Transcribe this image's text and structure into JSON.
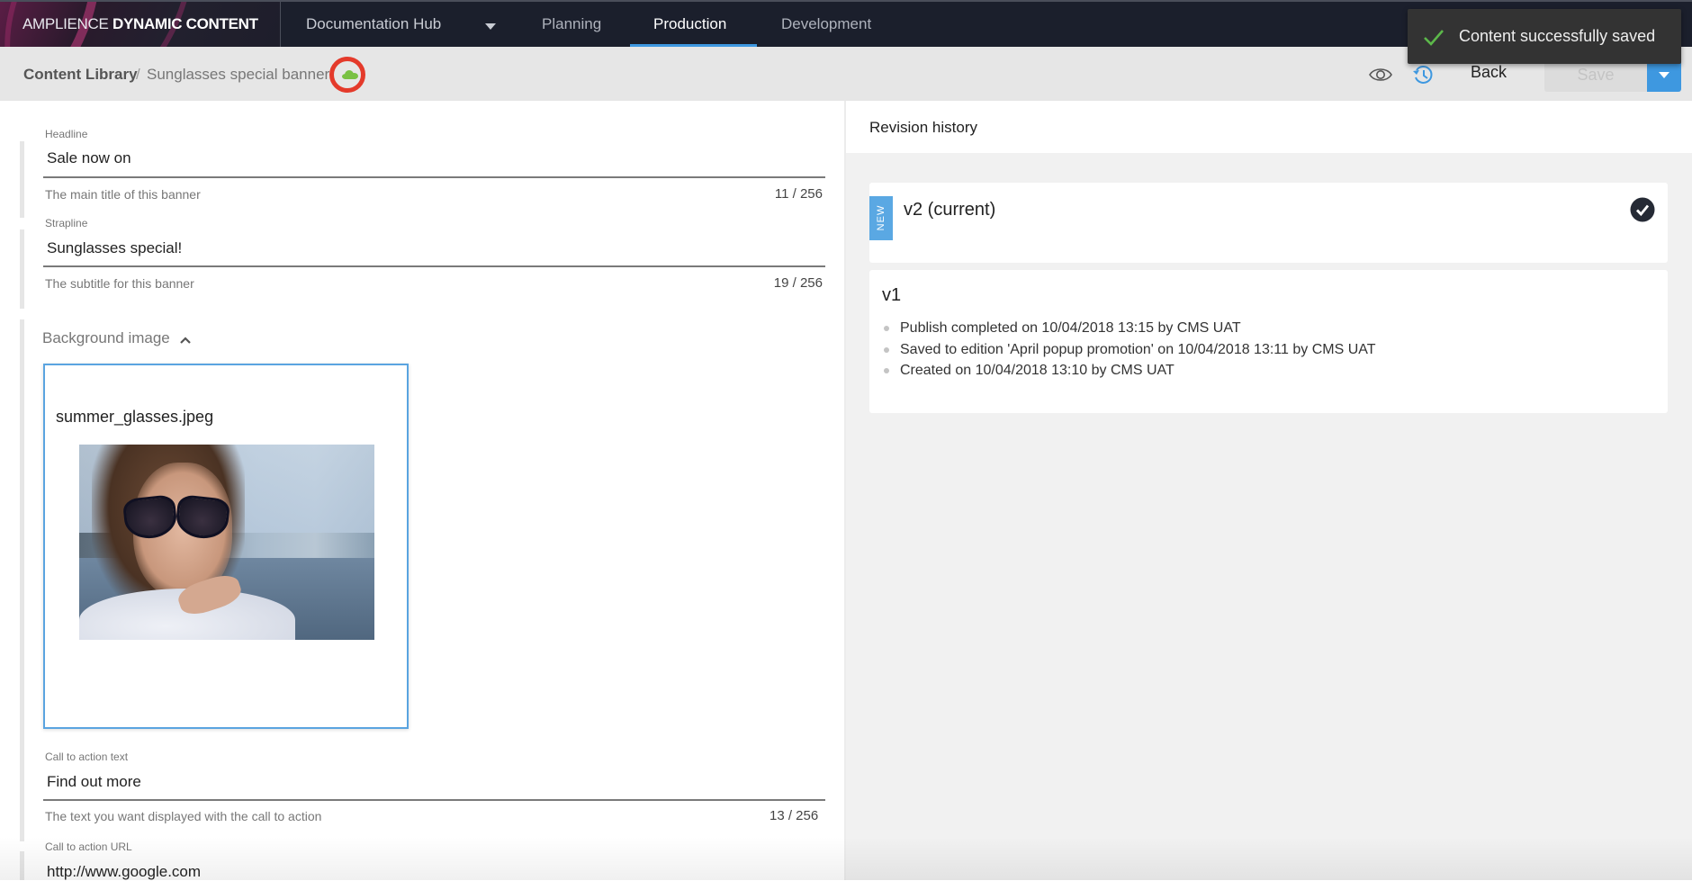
{
  "app": {
    "brand_light": "AMPLIENCE",
    "brand_bold": "DYNAMIC CONTENT",
    "hub_name": "Documentation Hub",
    "tabs": [
      {
        "label": "Planning",
        "active": false
      },
      {
        "label": "Production",
        "active": true
      },
      {
        "label": "Development",
        "active": false
      }
    ]
  },
  "breadcrumb": {
    "root": "Content Library",
    "separator": "/",
    "current": "Sunglasses special banner",
    "status_icon": "cloud-icon"
  },
  "toolbar": {
    "preview_icon": "eye-icon",
    "history_icon": "history-icon",
    "back_label": "Back",
    "save_label": "Save",
    "save_enabled": false,
    "save_menu_icon": "caret-down-icon"
  },
  "toast": {
    "icon": "check-icon",
    "message": "Content successfully saved"
  },
  "form": {
    "headline": {
      "label": "Headline",
      "value": "Sale now on",
      "help": "The main title of this banner",
      "count": "11 / 256"
    },
    "strapline": {
      "label": "Strapline",
      "value": "Sunglasses special!",
      "help": "The subtitle for this banner",
      "count": "19 / 256"
    },
    "background_image": {
      "label": "Background image",
      "expanded": true,
      "filename": "summer_glasses.jpeg"
    },
    "cta_text": {
      "label": "Call to action text",
      "value": "Find out more",
      "help": "The text you want displayed with the call to action",
      "count": "13 / 256"
    },
    "cta_url": {
      "label": "Call to action URL",
      "value": "http://www.google.com"
    }
  },
  "revision_history": {
    "title": "Revision history",
    "revisions": [
      {
        "badge": "NEW",
        "title": "v2 (current)",
        "current": true
      },
      {
        "title": "v1",
        "events": [
          "Publish completed on 10/04/2018 13:15 by CMS UAT",
          "Saved to edition 'April popup promotion' on 10/04/2018 13:11 by CMS UAT",
          "Created on 10/04/2018 13:10 by CMS UAT"
        ]
      }
    ]
  },
  "colors": {
    "accent": "#3e98e0",
    "nav_bg": "#1b1f2c",
    "status_ok": "#79c143",
    "highlight_ring": "#e43a2b",
    "toast_bg": "#333333"
  }
}
